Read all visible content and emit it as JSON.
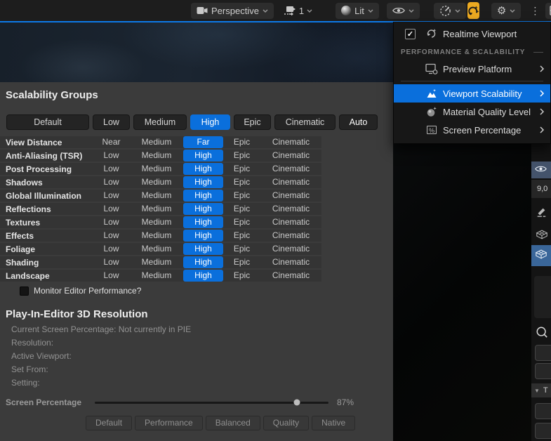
{
  "toolbar": {
    "perspective_label": "Perspective",
    "camera_speed": "1",
    "lit_label": "Lit"
  },
  "menu": {
    "realtime_label": "Realtime Viewport",
    "realtime_checked": true,
    "section_label": "PERFORMANCE & SCALABILITY",
    "items": [
      {
        "label": "Preview Platform",
        "has_submenu": true
      },
      {
        "label": "Viewport Scalability",
        "has_submenu": true,
        "highlighted": true
      },
      {
        "label": "Material Quality Level",
        "has_submenu": true
      },
      {
        "label": "Screen Percentage",
        "has_submenu": true
      }
    ]
  },
  "scalability": {
    "title": "Scalability Groups",
    "quality_buttons": [
      "Default",
      "Low",
      "Medium",
      "High",
      "Epic",
      "Cinematic",
      "Auto"
    ],
    "selected_quality": "High",
    "rows": [
      {
        "label": "View Distance",
        "options": [
          "Near",
          "Medium",
          "Far",
          "Epic",
          "Cinematic"
        ],
        "selected_index": 2
      },
      {
        "label": "Anti-Aliasing (TSR)",
        "options": [
          "Low",
          "Medium",
          "High",
          "Epic",
          "Cinematic"
        ],
        "selected_index": 2
      },
      {
        "label": "Post Processing",
        "options": [
          "Low",
          "Medium",
          "High",
          "Epic",
          "Cinematic"
        ],
        "selected_index": 2
      },
      {
        "label": "Shadows",
        "options": [
          "Low",
          "Medium",
          "High",
          "Epic",
          "Cinematic"
        ],
        "selected_index": 2
      },
      {
        "label": "Global Illumination",
        "options": [
          "Low",
          "Medium",
          "High",
          "Epic",
          "Cinematic"
        ],
        "selected_index": 2
      },
      {
        "label": "Reflections",
        "options": [
          "Low",
          "Medium",
          "High",
          "Epic",
          "Cinematic"
        ],
        "selected_index": 2
      },
      {
        "label": "Textures",
        "options": [
          "Low",
          "Medium",
          "High",
          "Epic",
          "Cinematic"
        ],
        "selected_index": 2
      },
      {
        "label": "Effects",
        "options": [
          "Low",
          "Medium",
          "High",
          "Epic",
          "Cinematic"
        ],
        "selected_index": 2
      },
      {
        "label": "Foliage",
        "options": [
          "Low",
          "Medium",
          "High",
          "Epic",
          "Cinematic"
        ],
        "selected_index": 2
      },
      {
        "label": "Shading",
        "options": [
          "Low",
          "Medium",
          "High",
          "Epic",
          "Cinematic"
        ],
        "selected_index": 2
      },
      {
        "label": "Landscape",
        "options": [
          "Low",
          "Medium",
          "High",
          "Epic",
          "Cinematic"
        ],
        "selected_index": 2
      }
    ],
    "monitor_label": "Monitor Editor Performance?",
    "monitor_checked": false
  },
  "pie": {
    "title": "Play-In-Editor 3D Resolution",
    "lines": [
      "Current Screen Percentage: Not currently in PIE",
      "Resolution:",
      "Active Viewport:",
      "Set From:",
      "Setting:"
    ],
    "screen_percentage_label": "Screen Percentage",
    "screen_percentage_value": "87%",
    "slider_percent": 86.5,
    "preset_buttons": [
      "Default",
      "Performance",
      "Balanced",
      "Quality",
      "Native"
    ]
  },
  "right_panel": {
    "value": "9,0",
    "section_fragment": "T"
  },
  "icons": {
    "check": "✓",
    "kebab": "⋮",
    "gear": "⚙",
    "collapse_triangle": "▼",
    "percent": "%"
  },
  "colors": {
    "accent_blue": "#0a6fdc",
    "highlight_orange": "#edaa21",
    "panel_bg": "#3b3b3b",
    "menu_bg": "#171717",
    "viewport_border_blue": "#0d79e8"
  }
}
